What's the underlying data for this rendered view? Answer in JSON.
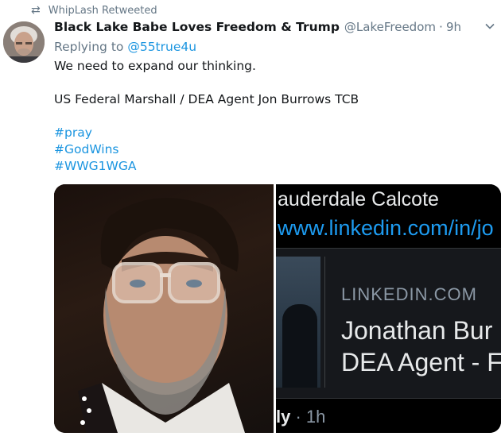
{
  "retweet": {
    "icon": "retweet-icon",
    "text": "WhipLash Retweeted"
  },
  "tweet": {
    "display_name": "Black Lake Babe Loves Freedom & Trump",
    "handle": "@LakeFreedom",
    "separator": "·",
    "time": "9h",
    "menu_icon": "chevron-down-icon",
    "replying_prefix": "Replying to",
    "replying_mention": "@55true4u",
    "line1": "We need to expand our thinking.",
    "line2": "US Federal Marshall / DEA Agent Jon Burrows TCB",
    "hashtags": [
      "#pray",
      "#GodWins",
      "#WWG1WGA"
    ]
  },
  "media": {
    "right_panel": {
      "header_text": "auderdale Calcote",
      "url_text": "www.linkedin.com/in/jo",
      "card_domain": "LINKEDIN.COM",
      "card_title_line1": "Jonathan Bur",
      "card_title_line2": "DEA Agent - F",
      "footer_tail": "ly",
      "footer_time": " · 1h"
    }
  },
  "colors": {
    "link": "#1b95e0",
    "muted": "#657786",
    "text": "#14171a"
  }
}
